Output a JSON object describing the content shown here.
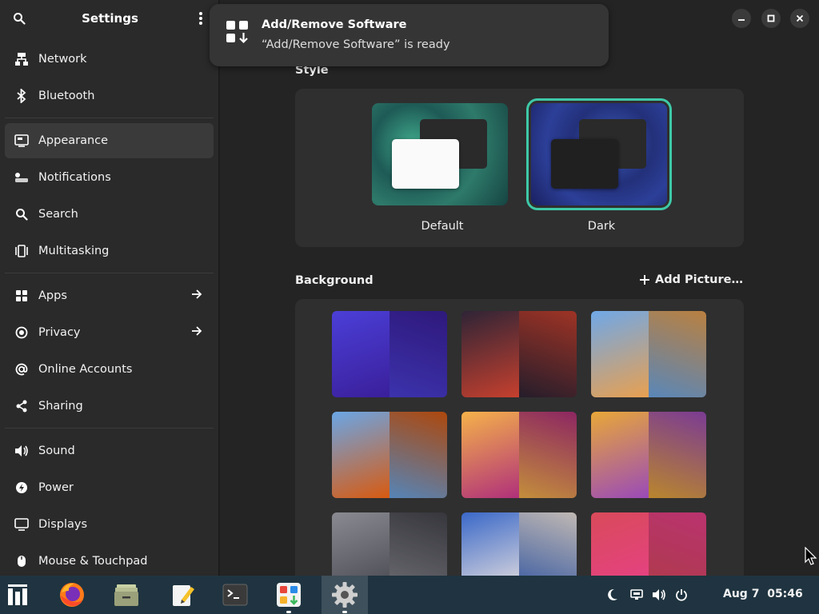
{
  "window": {
    "title": "Settings"
  },
  "sidebar": {
    "groups": [
      [
        {
          "label": "Network",
          "icon": "network-icon"
        },
        {
          "label": "Bluetooth",
          "icon": "bluetooth-icon"
        }
      ],
      [
        {
          "label": "Appearance",
          "icon": "appearance-icon",
          "active": true
        },
        {
          "label": "Notifications",
          "icon": "notifications-icon"
        },
        {
          "label": "Search",
          "icon": "search-icon"
        },
        {
          "label": "Multitasking",
          "icon": "multitasking-icon"
        }
      ],
      [
        {
          "label": "Apps",
          "icon": "apps-icon",
          "arrow": true
        },
        {
          "label": "Privacy",
          "icon": "privacy-icon",
          "arrow": true
        },
        {
          "label": "Online Accounts",
          "icon": "online-accounts-icon"
        },
        {
          "label": "Sharing",
          "icon": "sharing-icon"
        }
      ],
      [
        {
          "label": "Sound",
          "icon": "sound-icon"
        },
        {
          "label": "Power",
          "icon": "power-icon"
        },
        {
          "label": "Displays",
          "icon": "displays-icon"
        },
        {
          "label": "Mouse & Touchpad",
          "icon": "mouse-icon"
        }
      ]
    ]
  },
  "appearance": {
    "style_title": "Style",
    "styles": [
      {
        "label": "Default",
        "selected": false
      },
      {
        "label": "Dark",
        "selected": true
      }
    ],
    "background_title": "Background",
    "add_picture": "Add Picture…",
    "wallpapers": [
      {
        "left": "#4b3fd8",
        "right": "#3a1f9a"
      },
      {
        "left": "#2e2436",
        "right": "#c6402e"
      },
      {
        "left": "#6fa8e8",
        "right": "#e8a050"
      },
      {
        "left": "#6aa6e6",
        "right": "#d85a10"
      },
      {
        "left": "#f5b24a",
        "right": "#b0307a"
      },
      {
        "left": "#e8a838",
        "right": "#9a4ab8"
      },
      {
        "left": "#8a8a92",
        "right": "#44444c"
      },
      {
        "left": "#3a68c8",
        "right": "#f0e6e0"
      },
      {
        "left": "#d84a5a",
        "right": "#e8408a"
      }
    ]
  },
  "notification": {
    "title": "Add/Remove Software",
    "body": "“Add/Remove Software” is ready"
  },
  "taskbar": {
    "clock_date": "Aug 7",
    "clock_time": "05:46"
  },
  "colors": {
    "accent": "#3ec9a8",
    "taskbar": "#1f3440"
  }
}
